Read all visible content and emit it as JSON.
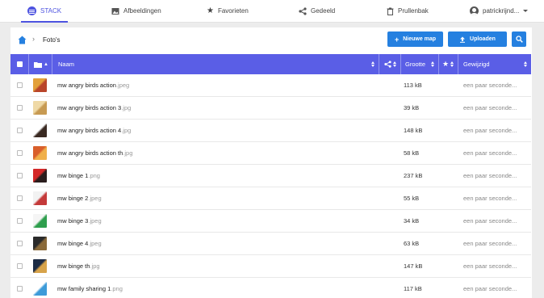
{
  "nav": {
    "tabs": [
      {
        "label": "STACK",
        "icon": "stack-logo-icon"
      },
      {
        "label": "Afbeeldingen",
        "icon": "image-icon"
      },
      {
        "label": "Favorieten",
        "icon": "star-icon"
      },
      {
        "label": "Gedeeld",
        "icon": "share-icon"
      },
      {
        "label": "Prullenbak",
        "icon": "trash-icon"
      }
    ],
    "user": "patrickrijnd..."
  },
  "toolbar": {
    "breadcrumb": "Foto's",
    "new_folder_label": "Nieuwe map",
    "upload_label": "Uploaden"
  },
  "table": {
    "columns": {
      "name": "Naam",
      "size": "Grootte",
      "modified": "Gewijzigd"
    },
    "rows": [
      {
        "name": "mw angry birds action",
        "ext": ".jpeg",
        "size": "113 kB",
        "modified": "een paar seconde...",
        "thumb": [
          "#e3a13a",
          "#b9452a"
        ]
      },
      {
        "name": "mw angry birds action 3",
        "ext": ".jpg",
        "size": "39 kB",
        "modified": "een paar seconde...",
        "thumb": [
          "#efd9a6",
          "#c79a52"
        ]
      },
      {
        "name": "mw angry birds action 4",
        "ext": ".jpg",
        "size": "148 kB",
        "modified": "een paar seconde...",
        "thumb": [
          "#ffffff",
          "#3a2a22"
        ]
      },
      {
        "name": "mw angry birds action th",
        "ext": ".jpg",
        "size": "58 kB",
        "modified": "een paar seconde...",
        "thumb": [
          "#d95f2b",
          "#f0b04a"
        ]
      },
      {
        "name": "mw binge 1",
        "ext": ".png",
        "size": "237 kB",
        "modified": "een paar seconde...",
        "thumb": [
          "#d42828",
          "#2a1d1d"
        ]
      },
      {
        "name": "mw binge 2",
        "ext": ".jpeg",
        "size": "55 kB",
        "modified": "een paar seconde...",
        "thumb": [
          "#f2f2f2",
          "#c43a3a"
        ]
      },
      {
        "name": "mw binge 3",
        "ext": ".jpeg",
        "size": "34 kB",
        "modified": "een paar seconde...",
        "thumb": [
          "#f5f5f5",
          "#2e9e4d"
        ]
      },
      {
        "name": "mw binge 4",
        "ext": ".jpeg",
        "size": "63 kB",
        "modified": "een paar seconde...",
        "thumb": [
          "#2a2a2a",
          "#8a6a3a"
        ]
      },
      {
        "name": "mw binge th",
        "ext": ".jpg",
        "size": "147 kB",
        "modified": "een paar seconde...",
        "thumb": [
          "#1c2b45",
          "#d7a34a"
        ]
      },
      {
        "name": "mw family sharing 1",
        "ext": ".png",
        "size": "117 kB",
        "modified": "een paar seconde...",
        "thumb": [
          "#ffffff",
          "#3d9bd9"
        ]
      }
    ]
  },
  "colors": {
    "accent": "#4d53e0",
    "header": "#5a5ee6",
    "button": "#2580e0"
  }
}
